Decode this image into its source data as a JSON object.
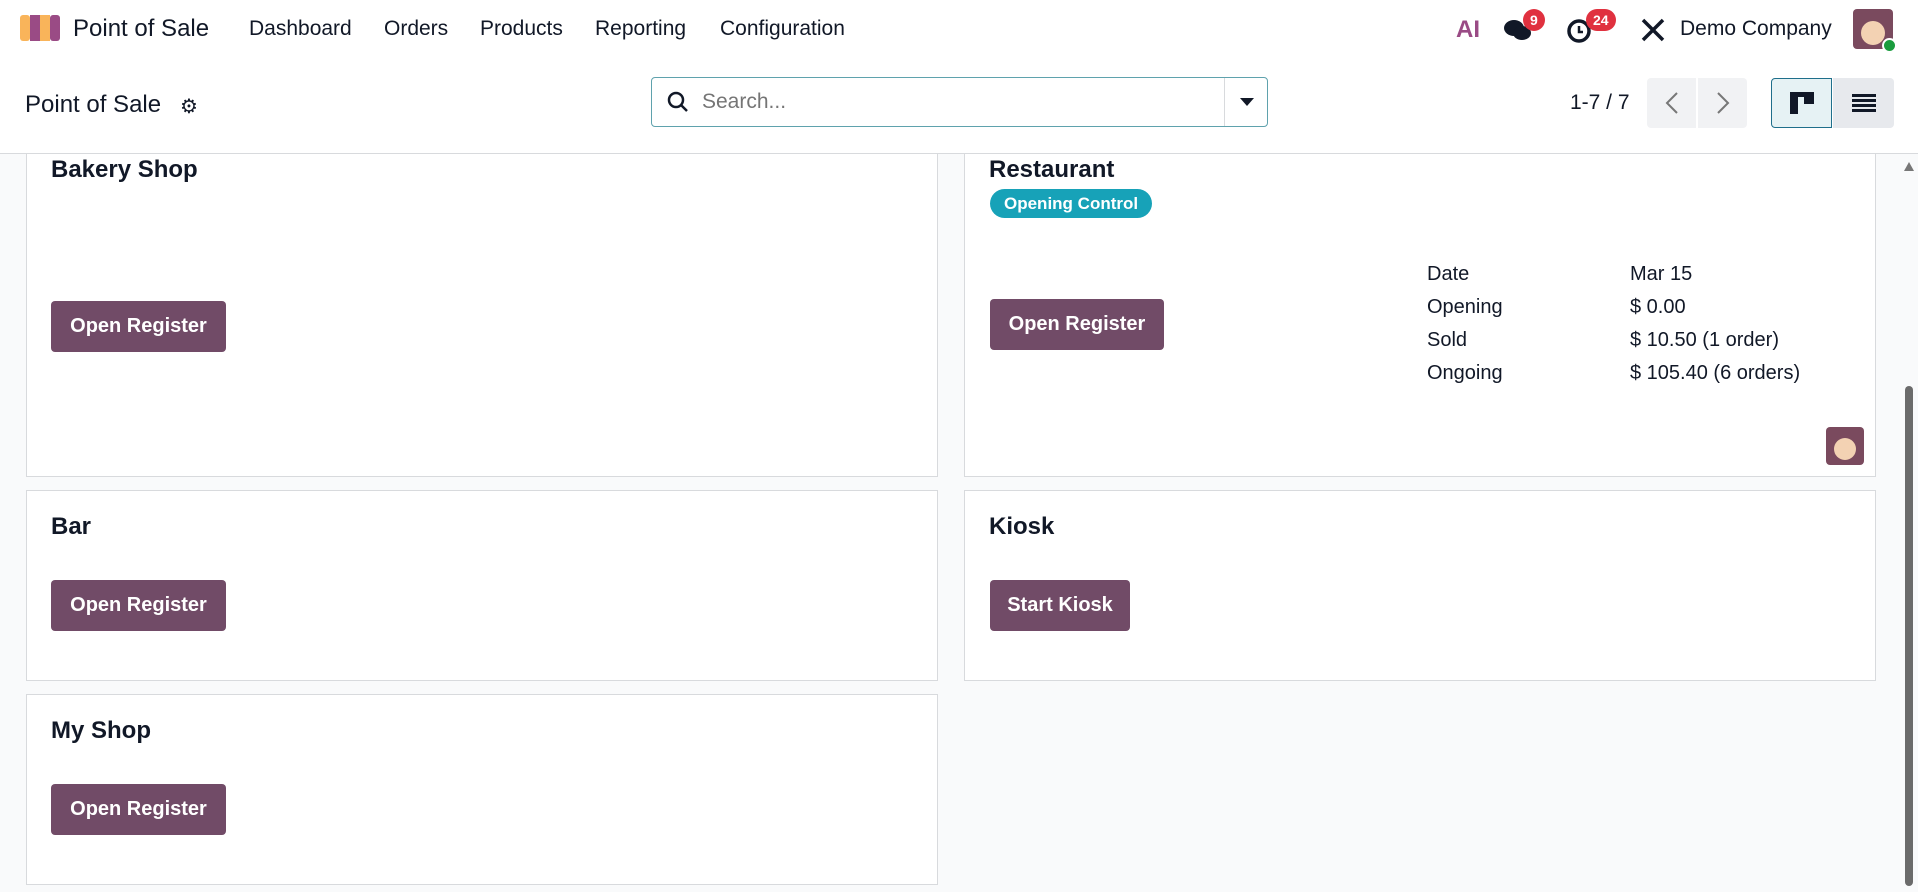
{
  "navbar": {
    "app": "Point of Sale",
    "menu": [
      "Dashboard",
      "Orders",
      "Products",
      "Reporting",
      "Configuration"
    ],
    "ai_label": "AI",
    "messages_count": "9",
    "activities_count": "24",
    "company": "Demo Company"
  },
  "control_panel": {
    "title": "Point of Sale",
    "search_placeholder": "Search...",
    "pager": "1-7 / 7"
  },
  "cards": [
    {
      "title": "Bakery Shop",
      "button": "Open Register"
    },
    {
      "title": "Restaurant",
      "badge": "Opening Control",
      "button": "Open Register",
      "details": [
        {
          "label": "Date",
          "value": "Mar 15"
        },
        {
          "label": "Opening",
          "value": "$ 0.00"
        },
        {
          "label": "Sold",
          "value": "$ 10.50 (1 order)"
        },
        {
          "label": "Ongoing",
          "value": "$ 105.40 (6 orders)"
        }
      ]
    },
    {
      "title": "Bar",
      "button": "Open Register"
    },
    {
      "title": "Kiosk",
      "button": "Start Kiosk"
    },
    {
      "title": "My Shop",
      "button": "Open Register"
    }
  ],
  "colors": {
    "primary": "#714b67",
    "badge_info": "#17a2b8",
    "notif": "#e0313f"
  }
}
